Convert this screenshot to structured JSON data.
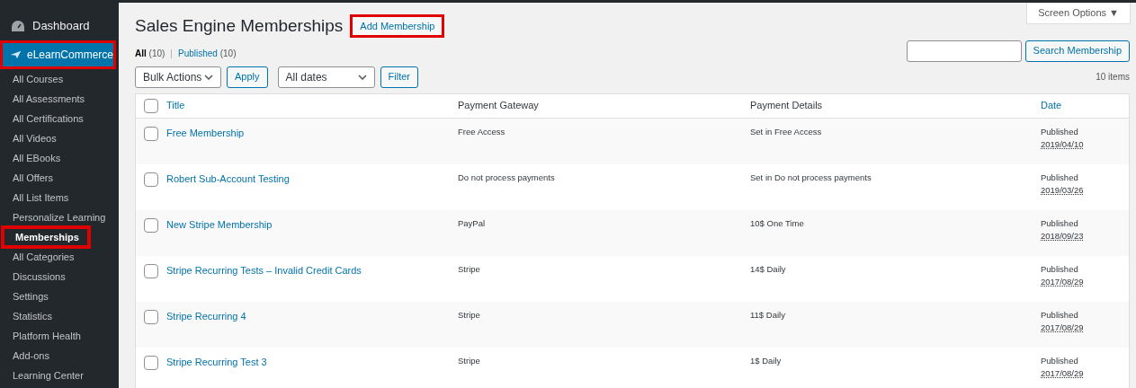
{
  "sidebar": {
    "items": [
      {
        "label": "Dashboard",
        "kind": "top",
        "selected": false,
        "highlighted": false
      },
      {
        "label": "eLearnCommerce",
        "kind": "brand",
        "selected": true,
        "highlighted": true
      },
      {
        "label": "All Courses",
        "kind": "sub",
        "selected": false,
        "highlighted": false
      },
      {
        "label": "All Assessments",
        "kind": "sub",
        "selected": false,
        "highlighted": false
      },
      {
        "label": "All Certifications",
        "kind": "sub",
        "selected": false,
        "highlighted": false
      },
      {
        "label": "All Videos",
        "kind": "sub",
        "selected": false,
        "highlighted": false
      },
      {
        "label": "All EBooks",
        "kind": "sub",
        "selected": false,
        "highlighted": false
      },
      {
        "label": "All Offers",
        "kind": "sub",
        "selected": false,
        "highlighted": false
      },
      {
        "label": "All List Items",
        "kind": "sub",
        "selected": false,
        "highlighted": false
      },
      {
        "label": "Personalize Learning",
        "kind": "sub",
        "selected": false,
        "highlighted": false
      },
      {
        "label": "Memberships",
        "kind": "sub",
        "selected": true,
        "highlighted": true
      },
      {
        "label": "All Categories",
        "kind": "sub",
        "selected": false,
        "highlighted": false
      },
      {
        "label": "Discussions",
        "kind": "sub",
        "selected": false,
        "highlighted": false
      },
      {
        "label": "Settings",
        "kind": "sub",
        "selected": false,
        "highlighted": false
      },
      {
        "label": "Statistics",
        "kind": "sub",
        "selected": false,
        "highlighted": false
      },
      {
        "label": "Platform Health",
        "kind": "sub",
        "selected": false,
        "highlighted": false
      },
      {
        "label": "Add-ons",
        "kind": "sub",
        "selected": false,
        "highlighted": false
      },
      {
        "label": "Learning Center",
        "kind": "sub",
        "selected": false,
        "highlighted": false
      }
    ]
  },
  "page": {
    "title": "Sales Engine Memberships",
    "add_button": {
      "label": "Add Membership",
      "highlighted": true
    },
    "screen_options": "Screen Options ▼"
  },
  "filter_separator": "|",
  "filters": [
    {
      "label": "All",
      "count": "(10)",
      "selected": true
    },
    {
      "label": "Published",
      "count": "(10)",
      "selected": false
    }
  ],
  "bulk_actions": {
    "value": "Bulk Actions",
    "button": "Apply"
  },
  "date_filter": {
    "value": "All dates",
    "button": "Filter"
  },
  "search": {
    "button": "Search Membership"
  },
  "item_count": "10 items",
  "table": {
    "select_all_checked": false,
    "columns": [
      "Title",
      "Payment Gateway",
      "Payment Details",
      "Date"
    ],
    "rows": [
      {
        "title": "Free Membership",
        "gateway": "Free Access",
        "details": "Set in Free Access",
        "status": "Published",
        "date": "2019/04/10",
        "checked": false
      },
      {
        "title": "Robert Sub-Account Testing",
        "gateway": "Do not process payments",
        "details": "Set in Do not process payments",
        "status": "Published",
        "date": "2019/03/26",
        "checked": false
      },
      {
        "title": "New Stripe Membership",
        "gateway": "PayPal",
        "details": "10$ One Time",
        "status": "Published",
        "date": "2018/09/23",
        "checked": false
      },
      {
        "title": "Stripe Recurring Tests – Invalid Credit Cards",
        "gateway": "Stripe",
        "details": "14$ Daily",
        "status": "Published",
        "date": "2017/08/29",
        "checked": false
      },
      {
        "title": "Stripe Recurring 4",
        "gateway": "Stripe",
        "details": "11$ Daily",
        "status": "Published",
        "date": "2017/08/29",
        "checked": false
      },
      {
        "title": "Stripe Recurring Test 3",
        "gateway": "Stripe",
        "details": "1$ Daily",
        "status": "Published",
        "date": "2017/08/29",
        "checked": false
      }
    ]
  }
}
